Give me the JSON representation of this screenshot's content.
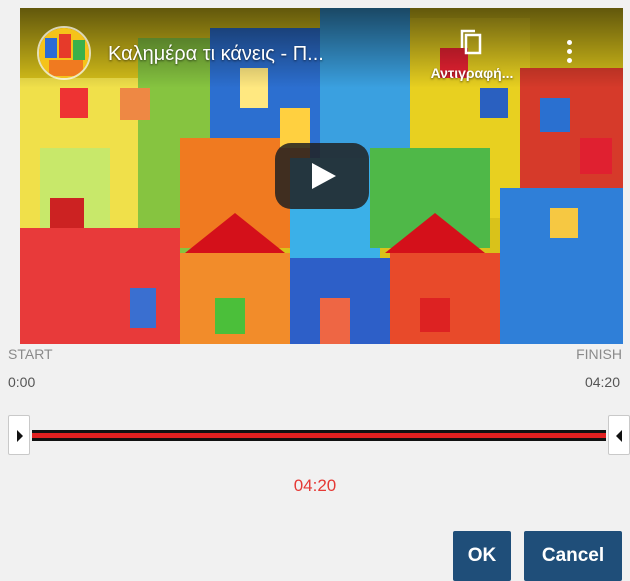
{
  "video": {
    "title": "Καλημέρα τι κάνεις - Π...",
    "copy_label": "Αντιγραφή...",
    "icons": [
      "channel-avatar",
      "copy-link-icon",
      "more-vert-icon",
      "play-icon"
    ]
  },
  "trim": {
    "start_label": "START",
    "finish_label": "FINISH",
    "start_time": "0:00",
    "finish_time": "04:20",
    "duration": "04:20",
    "selected_fraction_start": 0,
    "selected_fraction_end": 1
  },
  "buttons": {
    "ok": "OK",
    "cancel": "Cancel"
  },
  "colors": {
    "accent_red": "#e53935",
    "button_blue": "#1f4e79"
  }
}
